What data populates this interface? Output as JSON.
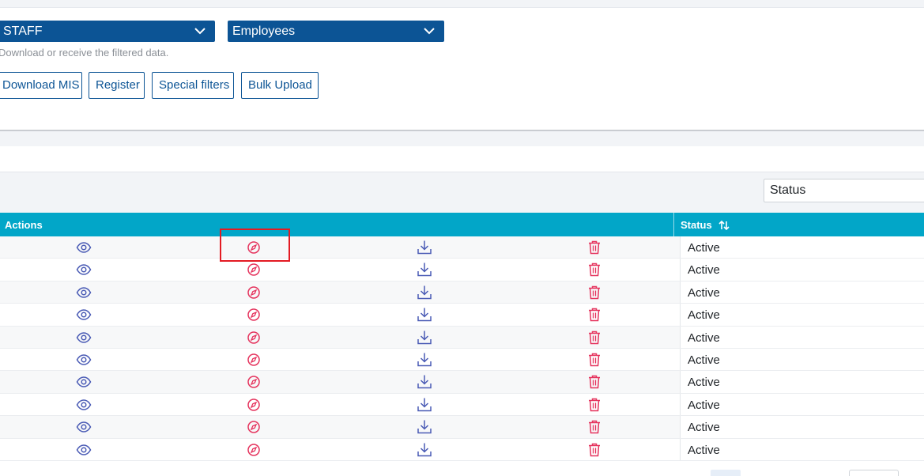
{
  "filters": {
    "staff_select": "STAFF",
    "employees_select": "Employees",
    "hint": "Download or receive the filtered data."
  },
  "buttons": {
    "download_mis": "Download MIS",
    "register": "Register",
    "special_filters": "Special filters",
    "bulk_upload": "Bulk Upload"
  },
  "search": {
    "status_placeholder": "Status"
  },
  "table": {
    "headers": {
      "actions": "Actions",
      "status": "Status"
    },
    "rows": [
      {
        "status": "Active"
      },
      {
        "status": "Active"
      },
      {
        "status": "Active"
      },
      {
        "status": "Active"
      },
      {
        "status": "Active"
      },
      {
        "status": "Active"
      },
      {
        "status": "Active"
      },
      {
        "status": "Active"
      },
      {
        "status": "Active"
      },
      {
        "status": "Active"
      }
    ],
    "row_icons": [
      "eye-icon",
      "compass-icon",
      "download-icon",
      "trash-icon"
    ]
  },
  "colors": {
    "primary": "#0c5495",
    "table_header": "#02a6c8",
    "icon_blue": "#4a5bb5",
    "icon_red": "#e5335d",
    "highlight": "#e31b23"
  }
}
